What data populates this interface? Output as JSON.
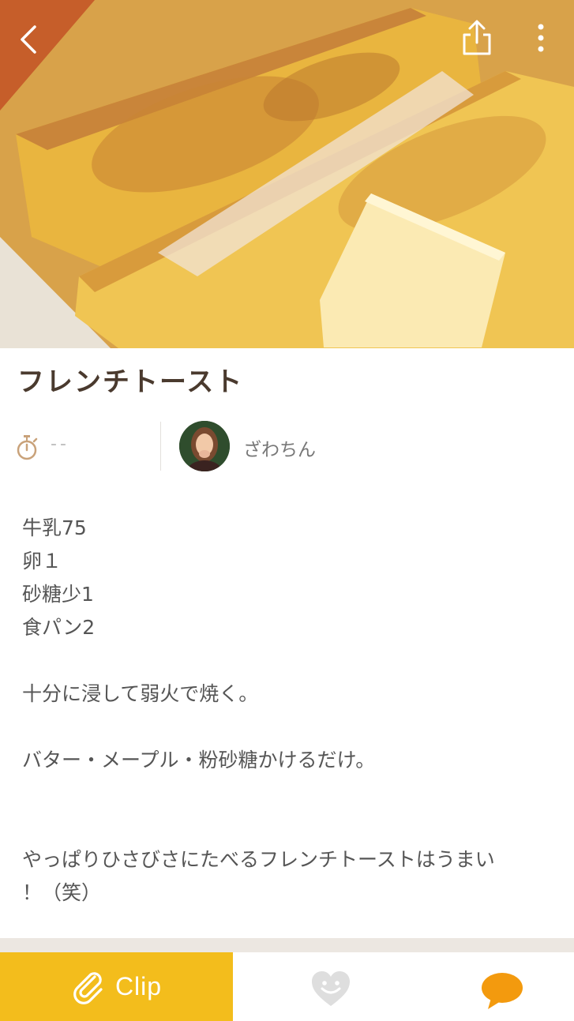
{
  "header": {
    "back_icon": "chevron-left-icon",
    "share_icon": "share-icon",
    "more_icon": "more-vertical-icon"
  },
  "recipe": {
    "title": "フレンチトースト",
    "time": "--",
    "author": "ざわちん",
    "description": "牛乳75\n卵１\n砂糖少1\n食パン2\n\n十分に浸して弱火で焼く。\n\nバター・メープル・粉砂糖かけるだけ。\n\n\nやっぱりひさびさにたべるフレンチトーストはうまい\n！（笑）"
  },
  "bottom_bar": {
    "clip_label": "Clip",
    "clip_icon": "paperclip-icon",
    "like_icon": "heart-smile-icon",
    "comment_icon": "speech-bubble-icon"
  },
  "colors": {
    "accent": "#f3bd1c",
    "comment": "#f39a0e",
    "title": "#4a3a2e",
    "timer": "#c9a27a"
  }
}
